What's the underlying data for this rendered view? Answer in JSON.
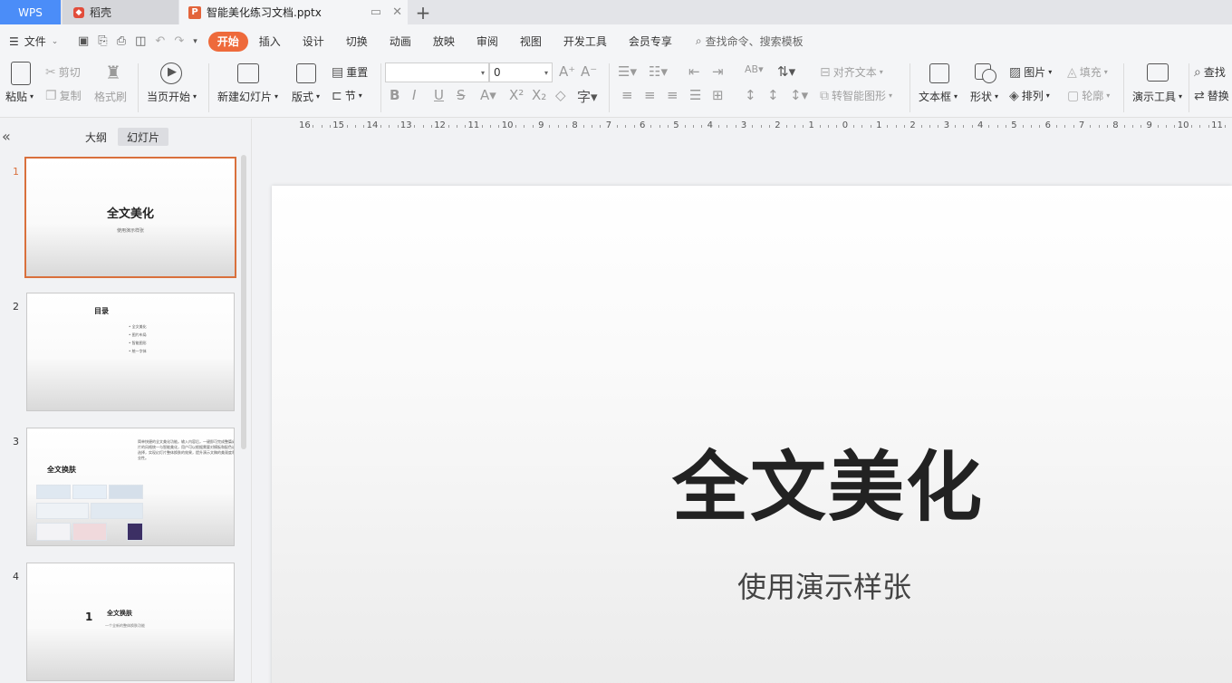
{
  "tabs": {
    "wps": "WPS",
    "daoke": "稻壳",
    "document": "智能美化练习文档.pptx",
    "add": "+"
  },
  "menu": {
    "file": "文件",
    "items": [
      "开始",
      "插入",
      "设计",
      "切换",
      "动画",
      "放映",
      "审阅",
      "视图",
      "开发工具",
      "会员专享"
    ],
    "active": "开始",
    "search": "查找命令、搜索模板"
  },
  "ribbon": {
    "paste": "粘贴",
    "cut": "剪切",
    "copy": "复制",
    "format_painter": "格式刷",
    "from_current": "当页开始",
    "new_slide": "新建幻灯片",
    "layout": "版式",
    "reset": "重置",
    "section": "节",
    "font_size": "0",
    "align_text": "对齐文本",
    "smart_shape": "转智能图形",
    "text_box": "文本框",
    "shape": "形状",
    "picture": "图片",
    "fill": "填充",
    "arrange": "排列",
    "outline": "轮廓",
    "presenter_tools": "演示工具",
    "find": "查找",
    "replace": "替换"
  },
  "left_pane": {
    "tab_outline": "大纲",
    "tab_slides": "幻灯片",
    "collapse": "«"
  },
  "thumbnails": [
    {
      "num": "1",
      "title": "全文美化",
      "subtitle": "使用演示样张"
    },
    {
      "num": "2",
      "title": "目录",
      "items": [
        "全文美化",
        "图片布局",
        "智能图形",
        "统一字体"
      ]
    },
    {
      "num": "3",
      "title": "全文换肤",
      "text": "简单快捷的全文美化功能。输入内容后，一键即可完成整篇幻灯片的风格统一与智能美化，用户可以根据需要对模板和配色进行选择，实现幻灯片整体换肤的效果，提升演示文稿的美观度和专业性。"
    },
    {
      "num": "4",
      "title": "全文换肤",
      "index": "1",
      "subtitle": "一个全新的整体换肤功能"
    }
  ],
  "ruler": [
    "16",
    "15",
    "14",
    "13",
    "12",
    "11",
    "10",
    "9",
    "8",
    "7",
    "6",
    "5",
    "4",
    "3",
    "2",
    "1",
    "0",
    "1",
    "2",
    "3",
    "4",
    "5",
    "6",
    "7",
    "8",
    "9",
    "10",
    "11"
  ],
  "slide": {
    "title": "全文美化",
    "subtitle": "使用演示样张"
  },
  "colors": {
    "accent": "#ee6a3b",
    "wps_tab": "#4b8df8",
    "selection": "#d9703c"
  }
}
